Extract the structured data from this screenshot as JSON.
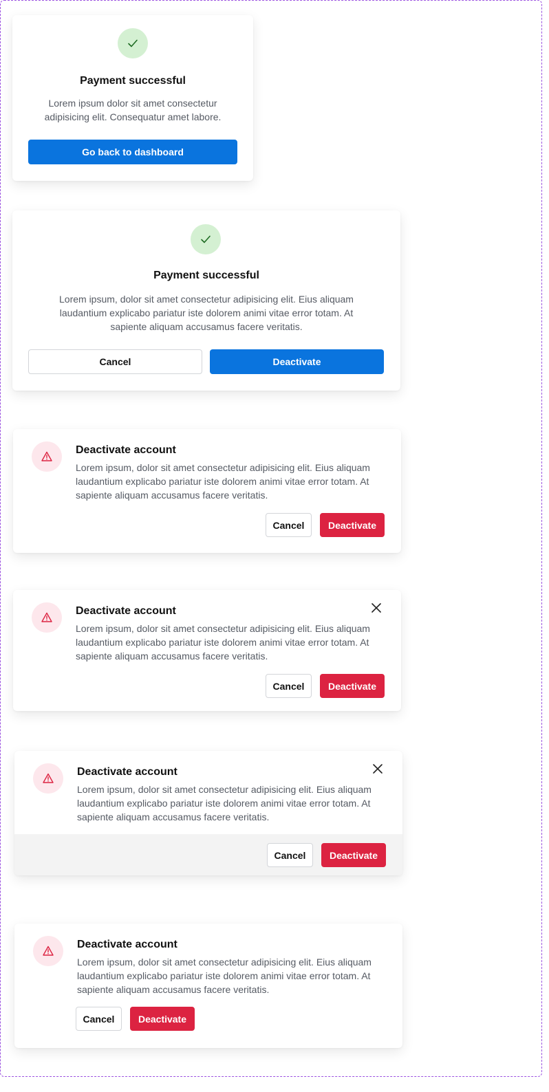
{
  "icons": {
    "success": "check-icon",
    "warning": "warning-triangle-icon",
    "close": "close-icon"
  },
  "colors": {
    "primary_blue": "#0a74de",
    "danger_red": "#dc2341",
    "success_bg": "#d4f0d2",
    "warning_bg": "#fde7ec",
    "frame_border": "#9b51e0"
  },
  "modal1": {
    "title": "Payment successful",
    "body": "Lorem ipsum dolor sit amet consectetur adipisicing elit. Consequatur amet labore.",
    "primary_button": "Go back to dashboard"
  },
  "modal2": {
    "title": "Payment successful",
    "body": "Lorem ipsum, dolor sit amet consectetur adipisicing elit. Eius aliquam laudantium explicabo pariatur iste dolorem animi vitae error totam. At sapiente aliquam accusamus facere veritatis.",
    "cancel_button": "Cancel",
    "primary_button": "Deactivate"
  },
  "modal3": {
    "title": "Deactivate account",
    "body": "Lorem ipsum, dolor sit amet consectetur adipisicing elit. Eius aliquam laudantium explicabo pariatur iste dolorem animi vitae error totam. At sapiente aliquam accusamus facere veritatis.",
    "cancel_button": "Cancel",
    "danger_button": "Deactivate"
  },
  "modal4": {
    "title": "Deactivate account",
    "body": "Lorem ipsum, dolor sit amet consectetur adipisicing elit. Eius aliquam laudantium explicabo pariatur iste dolorem animi vitae error totam. At sapiente aliquam accusamus facere veritatis.",
    "cancel_button": "Cancel",
    "danger_button": "Deactivate"
  },
  "modal5": {
    "title": "Deactivate account",
    "body": "Lorem ipsum, dolor sit amet consectetur adipisicing elit. Eius aliquam laudantium explicabo pariatur iste dolorem animi vitae error totam. At sapiente aliquam accusamus facere veritatis.",
    "cancel_button": "Cancel",
    "danger_button": "Deactivate"
  },
  "modal6": {
    "title": "Deactivate account",
    "body": "Lorem ipsum, dolor sit amet consectetur adipisicing elit. Eius aliquam laudantium explicabo pariatur iste dolorem animi vitae error totam. At sapiente aliquam accusamus facere veritatis.",
    "cancel_button": "Cancel",
    "danger_button": "Deactivate"
  }
}
